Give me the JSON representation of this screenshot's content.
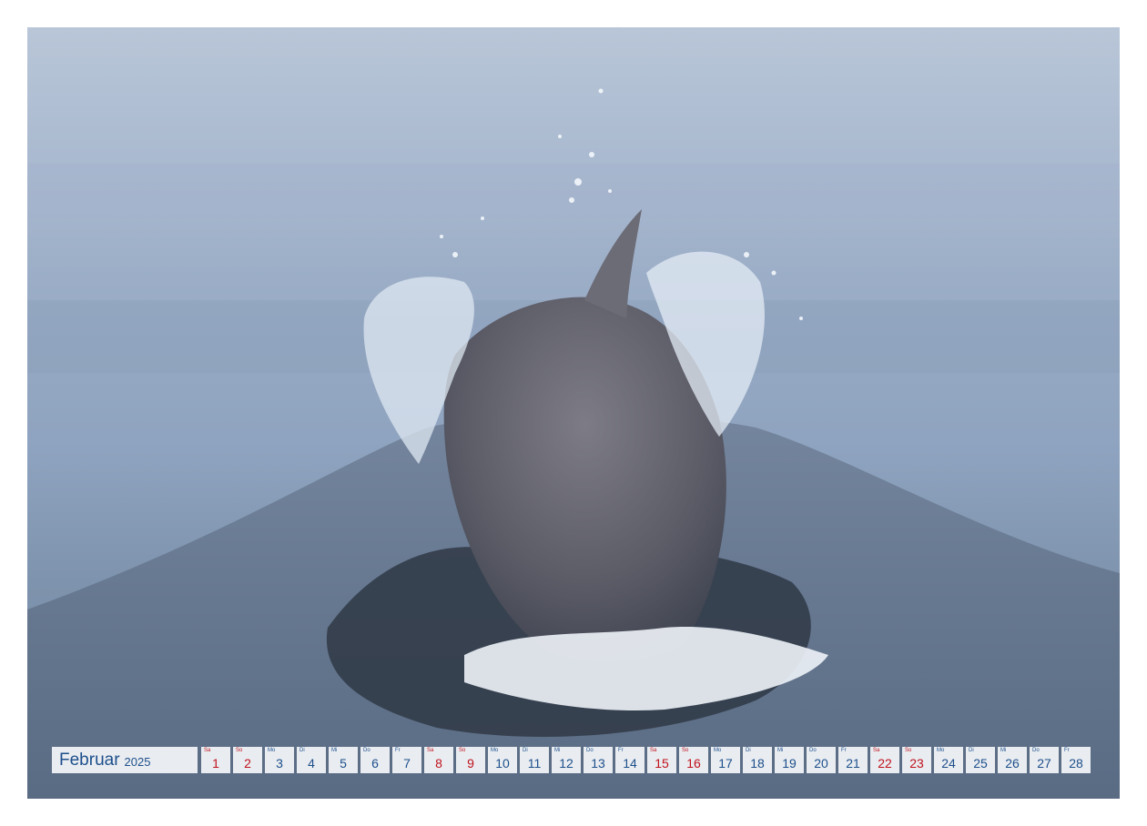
{
  "calendar": {
    "month": "Februar",
    "year": "2025",
    "days": [
      {
        "wd": "Sa",
        "d": "1",
        "weekend": true
      },
      {
        "wd": "So",
        "d": "2",
        "weekend": true
      },
      {
        "wd": "Mo",
        "d": "3",
        "weekend": false
      },
      {
        "wd": "Di",
        "d": "4",
        "weekend": false
      },
      {
        "wd": "Mi",
        "d": "5",
        "weekend": false
      },
      {
        "wd": "Do",
        "d": "6",
        "weekend": false
      },
      {
        "wd": "Fr",
        "d": "7",
        "weekend": false
      },
      {
        "wd": "Sa",
        "d": "8",
        "weekend": true
      },
      {
        "wd": "So",
        "d": "9",
        "weekend": true
      },
      {
        "wd": "Mo",
        "d": "10",
        "weekend": false
      },
      {
        "wd": "Di",
        "d": "11",
        "weekend": false
      },
      {
        "wd": "Mi",
        "d": "12",
        "weekend": false
      },
      {
        "wd": "Do",
        "d": "13",
        "weekend": false
      },
      {
        "wd": "Fr",
        "d": "14",
        "weekend": false
      },
      {
        "wd": "Sa",
        "d": "15",
        "weekend": true
      },
      {
        "wd": "So",
        "d": "16",
        "weekend": true
      },
      {
        "wd": "Mo",
        "d": "17",
        "weekend": false
      },
      {
        "wd": "Di",
        "d": "18",
        "weekend": false
      },
      {
        "wd": "Mi",
        "d": "19",
        "weekend": false
      },
      {
        "wd": "Do",
        "d": "20",
        "weekend": false
      },
      {
        "wd": "Fr",
        "d": "21",
        "weekend": false
      },
      {
        "wd": "Sa",
        "d": "22",
        "weekend": true
      },
      {
        "wd": "So",
        "d": "23",
        "weekend": true
      },
      {
        "wd": "Mo",
        "d": "24",
        "weekend": false
      },
      {
        "wd": "Di",
        "d": "25",
        "weekend": false
      },
      {
        "wd": "Mi",
        "d": "26",
        "weekend": false
      },
      {
        "wd": "Do",
        "d": "27",
        "weekend": false
      },
      {
        "wd": "Fr",
        "d": "28",
        "weekend": false
      }
    ]
  },
  "colors": {
    "text": "#1d4f8c",
    "weekend": "#c0121e",
    "sea": "#8ea3bf"
  }
}
